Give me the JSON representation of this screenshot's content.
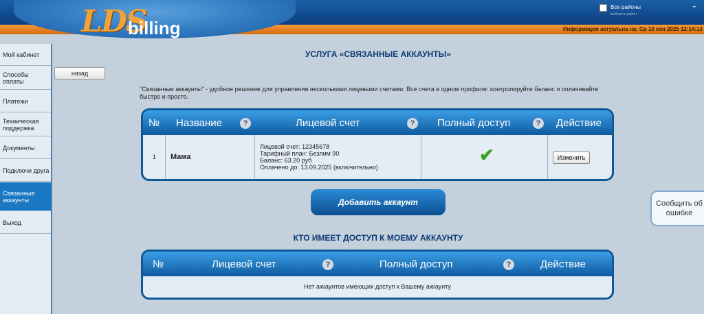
{
  "header": {
    "logo_lds": "LDS",
    "logo_billing": "billing",
    "regions_label": "Все районы",
    "regions_sub": "выберите район",
    "info": "Информация актуальна на: Ср 10 сен 2025 12:14:13"
  },
  "sidebar": {
    "items": [
      {
        "label": "Мой кабинет"
      },
      {
        "label": "Способы оплаты"
      },
      {
        "label": "Платежи"
      },
      {
        "label": "Техническая поддержка"
      },
      {
        "label": "Документы"
      },
      {
        "label": "Подключи друга"
      },
      {
        "label": "Связанные аккаунты",
        "active": true
      },
      {
        "label": "Выход"
      }
    ]
  },
  "main": {
    "back_label": "назад",
    "title": "УСЛУГА «СВЯЗАННЫЕ АККАУНТЫ»",
    "description": "\"Связанные аккаунты\" - удобное решение для управления несколькими лицевыми счетами. Все счета в одном профиле: контролируйте баланс и оплачивайте быстро и просто.",
    "accounts_table": {
      "headers": {
        "num": "№",
        "name": "Название",
        "account": "Лицевой счет",
        "full_access": "Полный доступ",
        "action": "Действие"
      },
      "rows": [
        {
          "num": "1",
          "name": "Мама",
          "account_line1": "Лицевой счет: 12345678",
          "account_line2": "Тарифный план: Безлим 90",
          "account_line3": "Баланс: 63.20 руб",
          "account_line4": "Оплачено до: 13.09.2025 (включительно)",
          "full_access": true,
          "action_label": "Изменить"
        }
      ]
    },
    "add_button": "Добавить аккаунт",
    "access_title": "КТО ИМЕЕТ ДОСТУП К МОЕМУ АККАУНТУ",
    "access_table": {
      "headers": {
        "num": "№",
        "account": "Лицевой счет",
        "full_access": "Полный доступ",
        "action": "Действие"
      },
      "empty_text": "Нет аккаунтов имеющих доступ к Вашему аккаунту"
    },
    "question_mark": "?",
    "check_mark": "✔"
  },
  "report_error": "Сообщить об ошибке"
}
